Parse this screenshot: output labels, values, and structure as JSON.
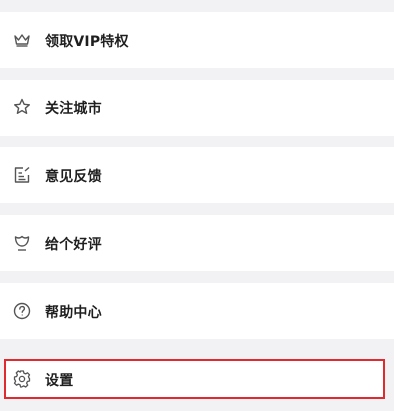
{
  "menu": {
    "items": [
      {
        "label": "领取VIP特权",
        "icon": "crown-icon"
      },
      {
        "label": "关注城市",
        "icon": "star-icon"
      },
      {
        "label": "意见反馈",
        "icon": "feedback-icon"
      },
      {
        "label": "给个好评",
        "icon": "tulip-icon"
      },
      {
        "label": "帮助中心",
        "icon": "help-circle-icon"
      },
      {
        "label": "设置",
        "icon": "gear-icon"
      }
    ]
  },
  "colors": {
    "background": "#f2f2f4",
    "row_background": "#ffffff",
    "text": "#1f1f1f",
    "icon": "#555555",
    "highlight_border": "#e02a2f"
  }
}
